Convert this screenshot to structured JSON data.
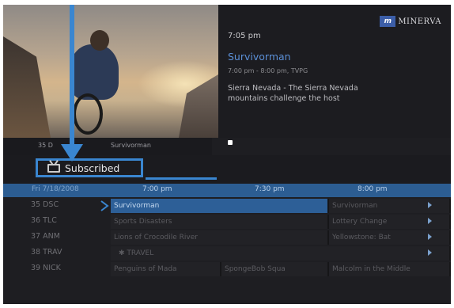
{
  "preview": {
    "mini_channel": "35 D",
    "mini_program": "Survivorman"
  },
  "info": {
    "logo_mark": "m",
    "logo_text": "MINERVA",
    "time": "7:05 pm",
    "title": "Survivorman",
    "subtitle": "7:00 pm - 8:00 pm, TVPG",
    "description": "Sierra Nevada - The Sierra Nevada mountains challenge the host"
  },
  "filter": {
    "label": "Subscribed"
  },
  "header": {
    "date": "Fri 7/18/2008",
    "times": [
      "7:00 pm",
      "7:30 pm",
      "8:00 pm"
    ]
  },
  "grid": {
    "rows": [
      {
        "channel": "35 DSC",
        "cells": [
          "Survivorman",
          "Survivorman"
        ]
      },
      {
        "channel": "36 TLC",
        "cells": [
          "Sports Disasters",
          "Lottery Change"
        ]
      },
      {
        "channel": "37 ANM",
        "cells": [
          "Lions of Crocodile River",
          "Yellowstone: Bat"
        ]
      },
      {
        "channel": "38 TRAV",
        "cells": [
          "TRAVEL"
        ]
      },
      {
        "channel": "39 NICK",
        "cells": [
          "Penguins of Mada",
          "SpongeBob Squa",
          "Malcolm in the Middle"
        ]
      }
    ]
  },
  "colors": {
    "accent": "#3a86d0",
    "selected": "#2d5f97",
    "title_blue": "#5b8fd6"
  }
}
